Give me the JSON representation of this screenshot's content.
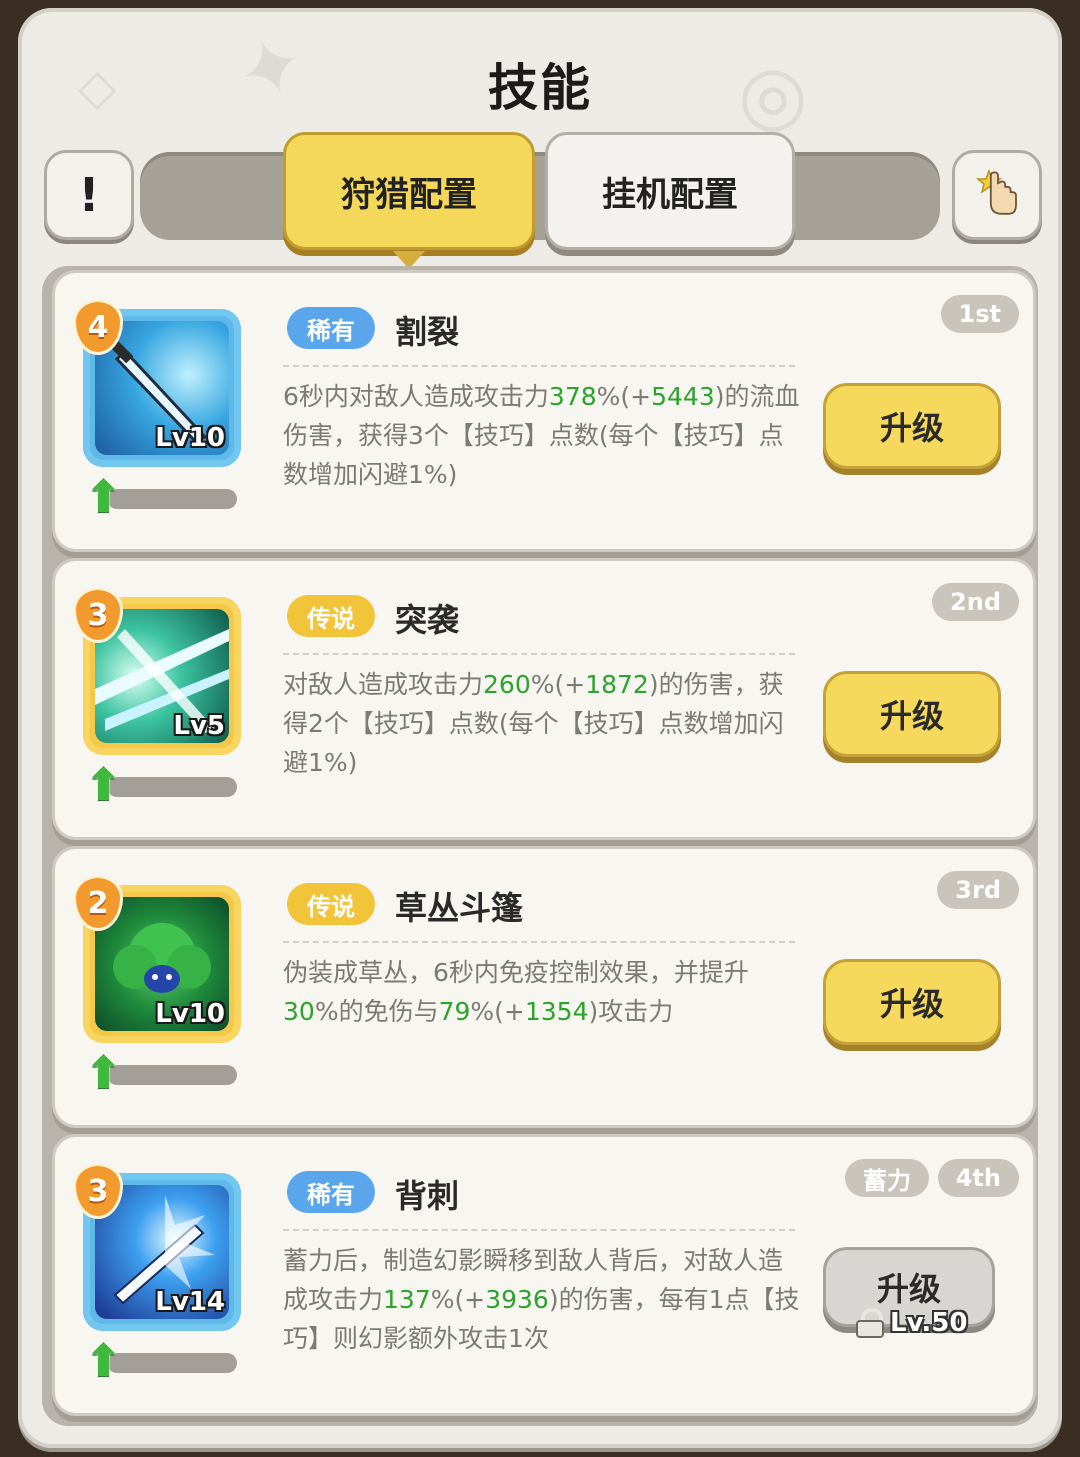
{
  "header": {
    "title": "技能",
    "info_button_glyph": "!",
    "tabs": [
      {
        "label": "狩猎配置",
        "active": true
      },
      {
        "label": "挂机配置",
        "active": false
      }
    ]
  },
  "skills": [
    {
      "order": "4",
      "level": "Lv10",
      "rarity": "稀有",
      "name": "割裂",
      "rank": "1st",
      "desc_parts": [
        "6秒内对敌人造成攻击力",
        "378",
        "%(+",
        "5443",
        ")的流血伤害，获得3个【技巧】点数(每个【技巧】点数增加闪避1%)"
      ],
      "button": "升级"
    },
    {
      "order": "3",
      "level": "Lv5",
      "rarity": "传说",
      "name": "突袭",
      "rank": "2nd",
      "desc_parts": [
        "对敌人造成攻击力",
        "260",
        "%(+",
        "1872",
        ")的伤害，获得2个【技巧】点数(每个【技巧】点数增加闪避1%)"
      ],
      "button": "升级"
    },
    {
      "order": "2",
      "level": "Lv10",
      "rarity": "传说",
      "name": "草丛斗篷",
      "rank": "3rd",
      "desc_parts": [
        "伪装成草丛，6秒内免疫控制效果，并提升",
        "30",
        "%的免伤与",
        "79",
        "%(+",
        "1354",
        ")攻击力"
      ],
      "button": "升级"
    },
    {
      "order": "3",
      "level": "Lv14",
      "rarity": "稀有",
      "name": "背刺",
      "rank": "4th",
      "charge_tag": "蓄力",
      "desc_parts": [
        "蓄力后，制造幻影瞬移到敌人背后，对敌人造成攻击力",
        "137",
        "%(+",
        "3936",
        ")的伤害，每有1点【技巧】则幻影额外攻击1次"
      ],
      "button": "升级",
      "lock_text": "Lv.50"
    }
  ],
  "colors": {
    "highlight": "#2ca32c",
    "rare": "#5aa6ec",
    "legend": "#f1c43a",
    "button_yellow": "#f6d95c"
  },
  "icons": {
    "info": "exclamation-icon",
    "settings": "hand-tap-icon",
    "lock": "lock-icon",
    "level_up": "green-up-arrow-icon"
  }
}
